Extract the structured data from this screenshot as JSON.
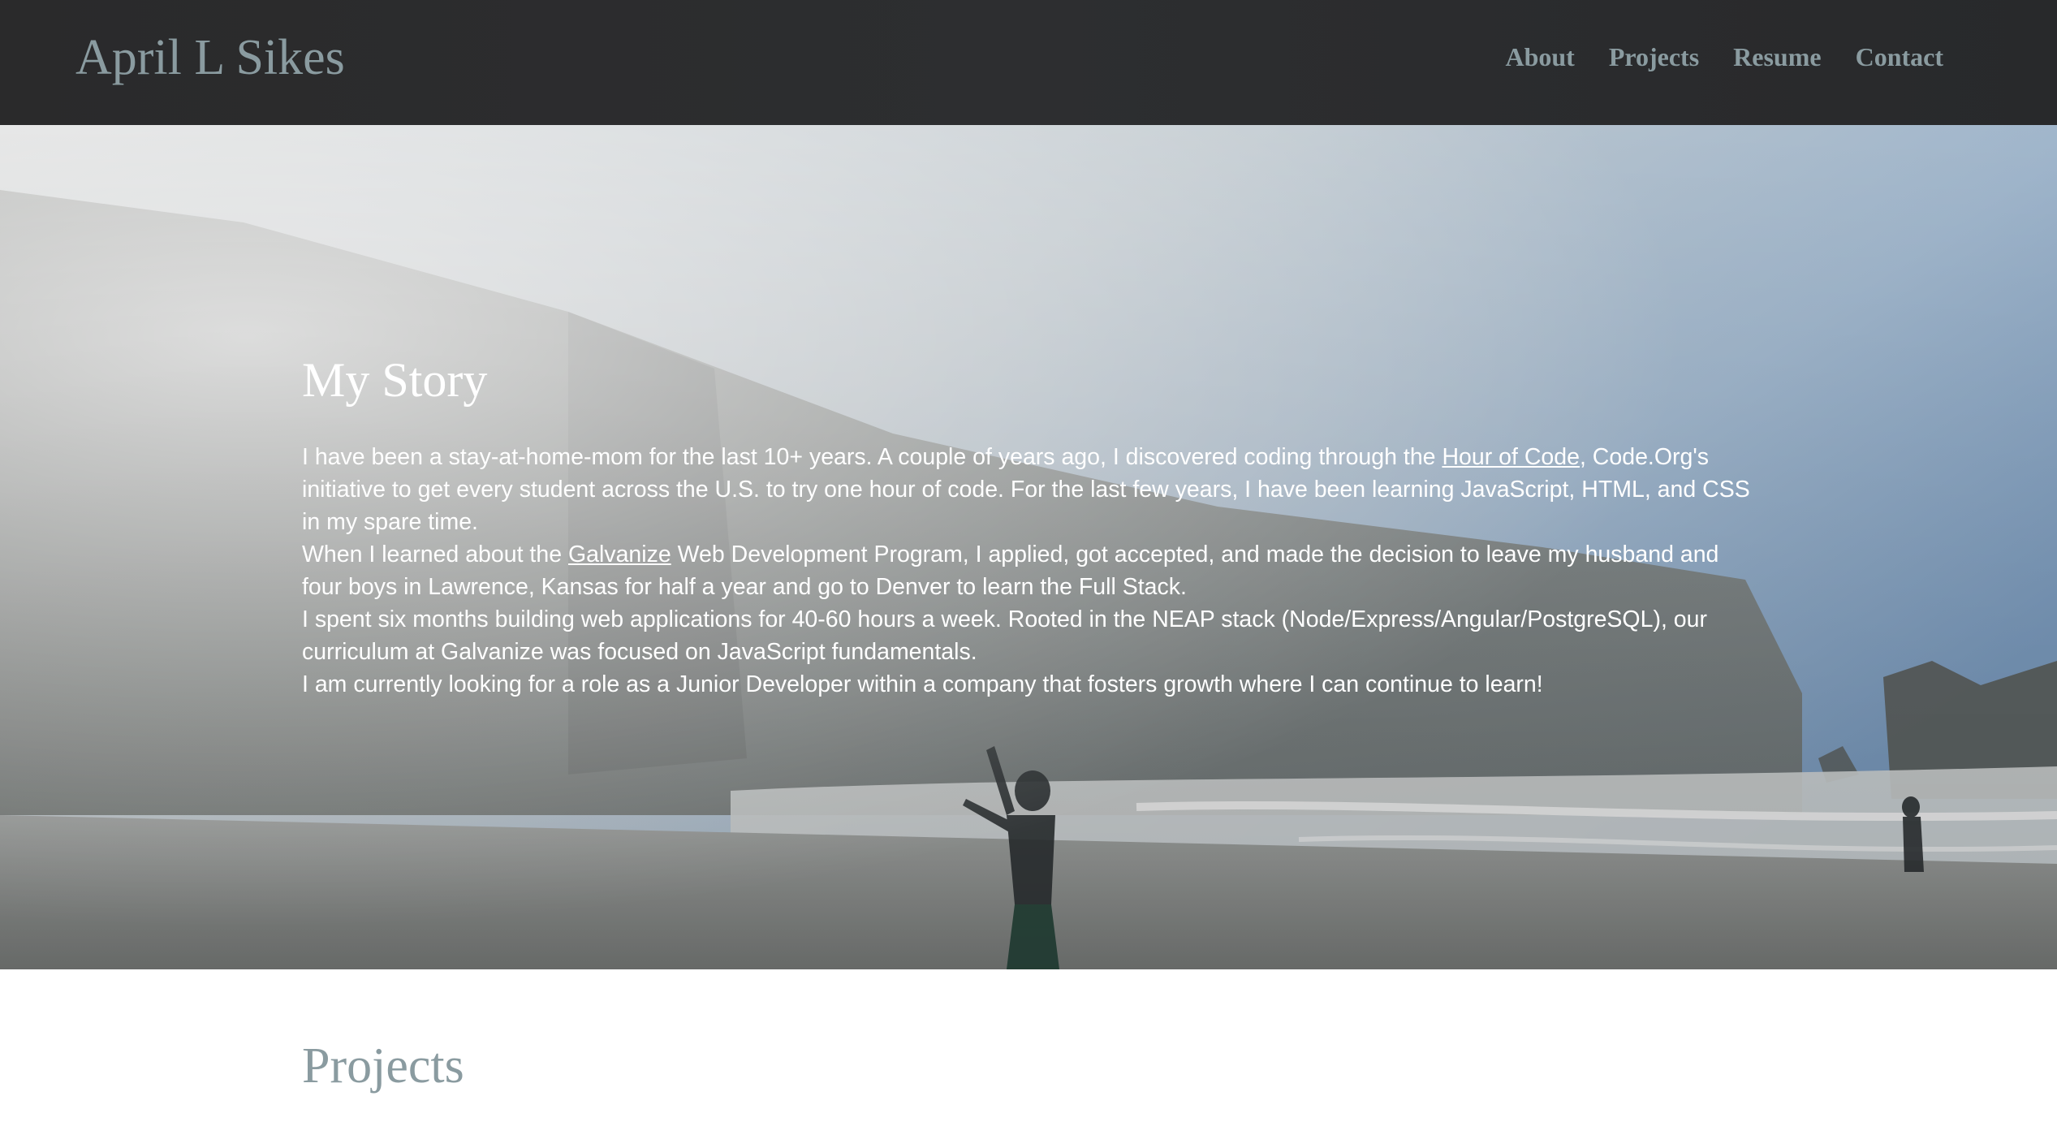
{
  "header": {
    "brand": "April L Sikes",
    "nav": [
      {
        "label": "About"
      },
      {
        "label": "Projects"
      },
      {
        "label": "Resume"
      },
      {
        "label": "Contact"
      }
    ]
  },
  "story": {
    "title": "My Story",
    "paragraphs": [
      {
        "text_before": "I have been a stay-at-home-mom for the last 10+ years. A couple of years ago, I discovered coding through the ",
        "link": "Hour of Code",
        "text_after": ", Code.Org's initiative to get every student across the U.S. to try one hour of code. For the last few years, I have been learning JavaScript, HTML, and CSS in my spare time."
      },
      {
        "text_before": "When I learned about the ",
        "link": "Galvanize",
        "text_after": " Web Development Program, I applied, got accepted, and made the decision to leave my husband and four boys in Lawrence, Kansas for half a year and go to Denver to learn the Full Stack."
      },
      {
        "text": "I spent six months building web applications for 40-60 hours a week. Rooted in the NEAP stack (Node/Express/Angular/PostgreSQL), our curriculum at Galvanize was focused on JavaScript fundamentals."
      },
      {
        "text": "I am currently looking for a role as a Junior Developer within a company that fosters growth where I can continue to learn!"
      }
    ]
  },
  "projects": {
    "title": "Projects"
  },
  "colors": {
    "nav_background": "#2c2d2f",
    "nav_text": "#8a9ba0",
    "hero_text": "#ffffff",
    "section_title": "#8a9ba0"
  },
  "icons": {
    "hero_image": "beach-photo-background"
  }
}
